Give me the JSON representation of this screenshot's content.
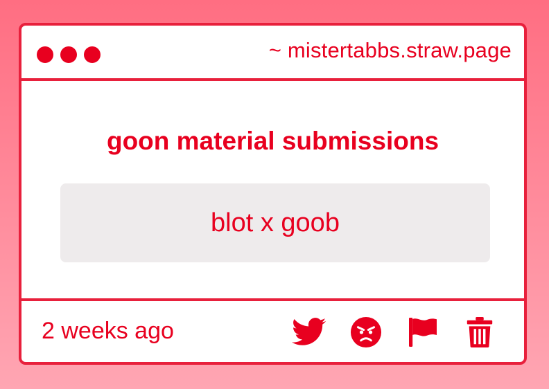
{
  "browser": {
    "url": "~ mistertabbs.straw.page"
  },
  "main": {
    "heading": "goon material submissions",
    "entry_text": "blot x goob"
  },
  "footer": {
    "timestamp": "2 weeks ago",
    "actions": [
      {
        "icon": "twitter-bird-icon"
      },
      {
        "icon": "angry-face-icon"
      },
      {
        "icon": "flag-icon"
      },
      {
        "icon": "trash-icon"
      }
    ]
  },
  "colors": {
    "accent": "#e8001f",
    "border": "#e8203c",
    "entry_background": "#eeebec",
    "page_background_top": "#ff6e82",
    "page_background_bottom": "#ffa6b3"
  }
}
